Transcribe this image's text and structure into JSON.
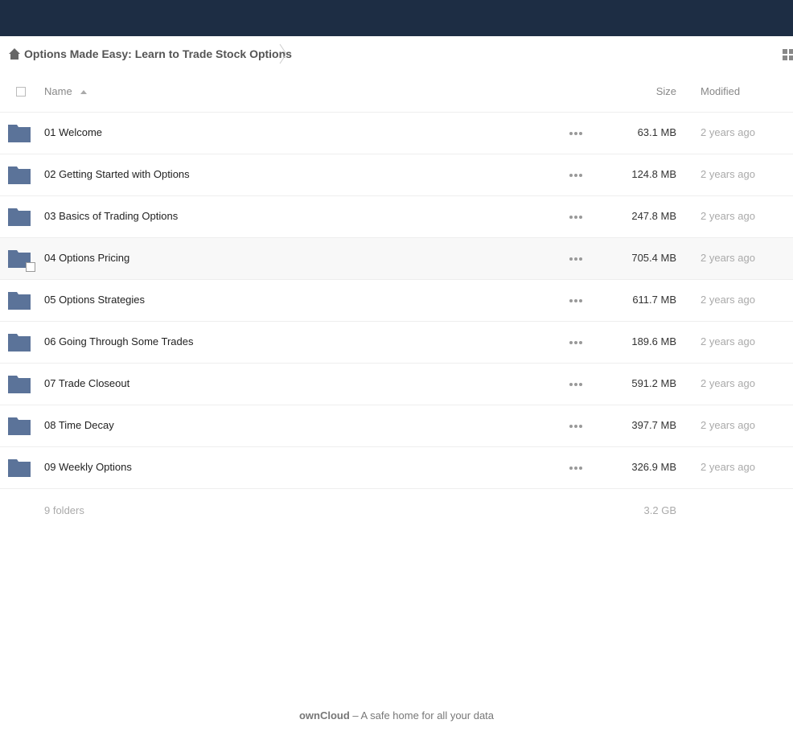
{
  "breadcrumb": {
    "home_icon": "home-icon",
    "current_folder": "Options Made Easy: Learn to Trade Stock Options"
  },
  "header": {
    "name_label": "Name",
    "size_label": "Size",
    "modified_label": "Modified",
    "sort_icon": "sort-ascending-icon"
  },
  "files": [
    {
      "name": "01 Welcome",
      "size": "63.1 MB",
      "modified": "2 years ago"
    },
    {
      "name": "02 Getting Started with Options",
      "size": "124.8 MB",
      "modified": "2 years ago"
    },
    {
      "name": "03 Basics of Trading Options",
      "size": "247.8 MB",
      "modified": "2 years ago"
    },
    {
      "name": "04 Options Pricing",
      "size": "705.4 MB",
      "modified": "2 years ago"
    },
    {
      "name": "05 Options Strategies",
      "size": "611.7 MB",
      "modified": "2 years ago"
    },
    {
      "name": "06 Going Through Some Trades",
      "size": "189.6 MB",
      "modified": "2 years ago"
    },
    {
      "name": "07 Trade Closeout",
      "size": "591.2 MB",
      "modified": "2 years ago"
    },
    {
      "name": "08 Time Decay",
      "size": "397.7 MB",
      "modified": "2 years ago"
    },
    {
      "name": "09 Weekly Options",
      "size": "326.9 MB",
      "modified": "2 years ago"
    }
  ],
  "summary": {
    "count": "9 folders",
    "total_size": "3.2 GB"
  },
  "footer": {
    "brand": "ownCloud",
    "tagline": " – A safe home for all your data"
  },
  "colors": {
    "topbar": "#1d2d44",
    "folder": "#5b7399"
  }
}
